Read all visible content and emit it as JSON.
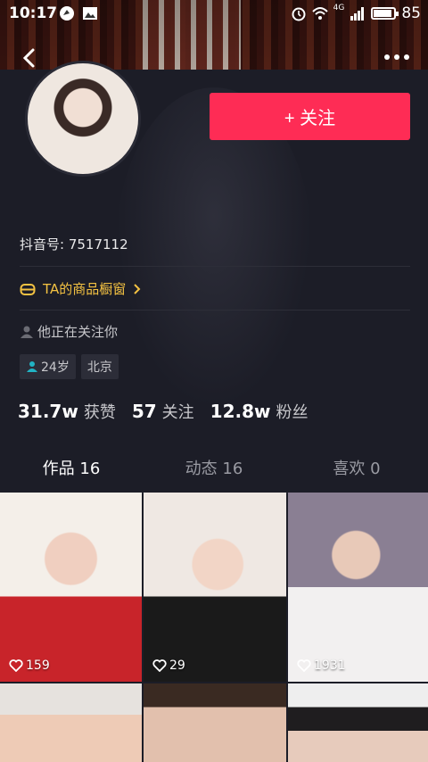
{
  "status_bar": {
    "time": "10:17",
    "battery": "85",
    "signal_label": "4G"
  },
  "profile": {
    "follow_label": "+ 关注",
    "douyin_id": "抖音号: 7517112",
    "shop_label": "TA的商品橱窗",
    "follow_status": "他正在关注你",
    "tags": [
      {
        "label": "24岁",
        "icon": "person-icon"
      },
      {
        "label": "北京"
      }
    ],
    "stats": [
      {
        "value": "31.7w",
        "label": "获赞"
      },
      {
        "value": "57",
        "label": "关注"
      },
      {
        "value": "12.8w",
        "label": "粉丝"
      }
    ]
  },
  "tabs": [
    {
      "label": "作品 16",
      "active": true
    },
    {
      "label": "动态 16",
      "active": false
    },
    {
      "label": "喜欢 0",
      "active": false
    }
  ],
  "videos": [
    {
      "likes": "159"
    },
    {
      "likes": "29"
    },
    {
      "likes": "1931"
    },
    {
      "likes": ""
    },
    {
      "likes": ""
    },
    {
      "likes": ""
    }
  ],
  "colors": {
    "accent": "#fe2c55",
    "highlight": "#f4c242",
    "background": "#161823"
  }
}
